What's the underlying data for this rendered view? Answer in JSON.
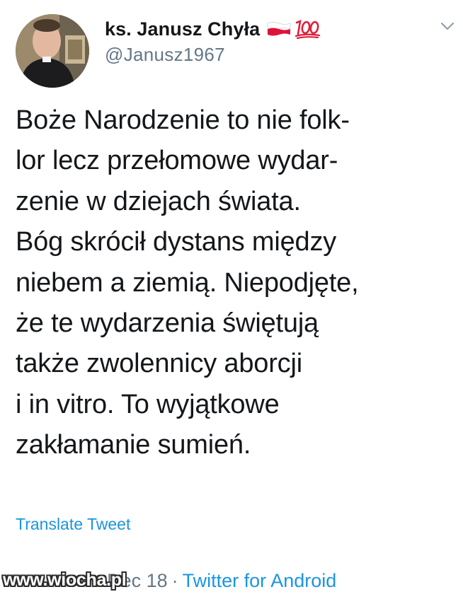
{
  "author": {
    "display_name": "ks. Janusz Chyła",
    "handle": "@Janusz1967",
    "badges": [
      "poland-flag-icon",
      "hundred-points-icon"
    ],
    "avatar_icon": "profile-photo"
  },
  "tweet": {
    "text": "Boże Narodzenie to nie folk-\nlor lecz przełomowe wydar-\nzenie w dziejach świata.\nBóg skrócił dystans między\nniebem a ziemią. Niepodjęte,\nże te wydarzenia świętują\ntakże zwolennicy aborcji\ni in vitro. To wyjątkowe\nzakłamanie sumień.",
    "translate_label": "Translate Tweet",
    "date": "Dec 18",
    "separator": "·",
    "source": "Twitter for Android"
  },
  "menu": {
    "icon": "chevron-down-icon"
  },
  "watermark": {
    "text": "www.wiocha.pl"
  },
  "colors": {
    "text": "#14171a",
    "secondary": "#657786",
    "link": "#1b95e0",
    "flag_white": "#ffffff",
    "flag_red": "#dc143c",
    "hundred_red": "#e0203a"
  }
}
